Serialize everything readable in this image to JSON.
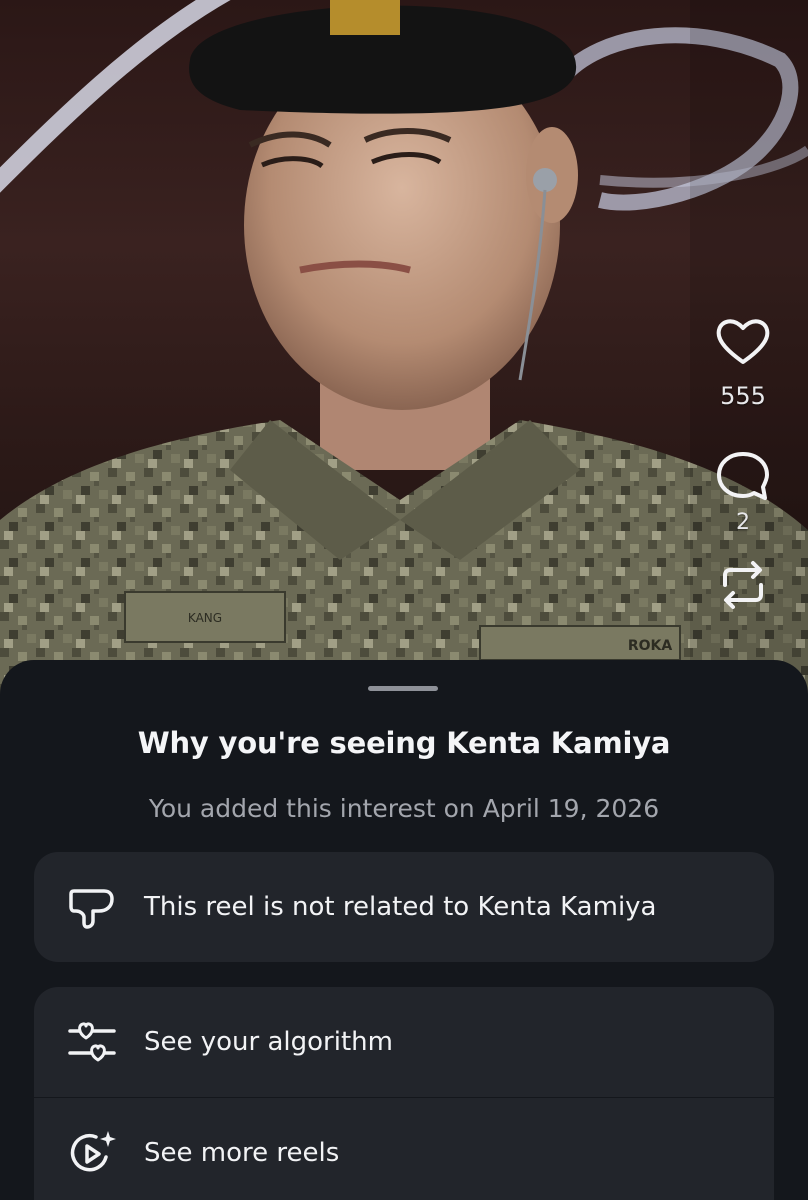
{
  "reel": {
    "actions": {
      "like": {
        "icon": "heart-icon",
        "count": "555"
      },
      "comment": {
        "icon": "comment-icon",
        "count": "2"
      },
      "repost": {
        "icon": "repost-icon"
      }
    },
    "uniform_patch_name": "KANG",
    "uniform_patch_unit": "ROKA"
  },
  "sheet": {
    "title": "Why you're seeing Kenta Kamiya",
    "subtitle": "You added this interest on April 19, 2026",
    "options": [
      {
        "icon": "thumbs-down-icon",
        "label": "This reel is not related to Kenta Kamiya"
      },
      {
        "icon": "algorithm-sliders-icon",
        "label": "See your algorithm"
      },
      {
        "icon": "reels-sparkle-icon",
        "label": "See more reels"
      }
    ]
  },
  "colors": {
    "sheet_background": "#14171c",
    "card_background": "#22252b",
    "title_text": "#f4f5f7",
    "subtitle_text": "#a3a6ad"
  }
}
